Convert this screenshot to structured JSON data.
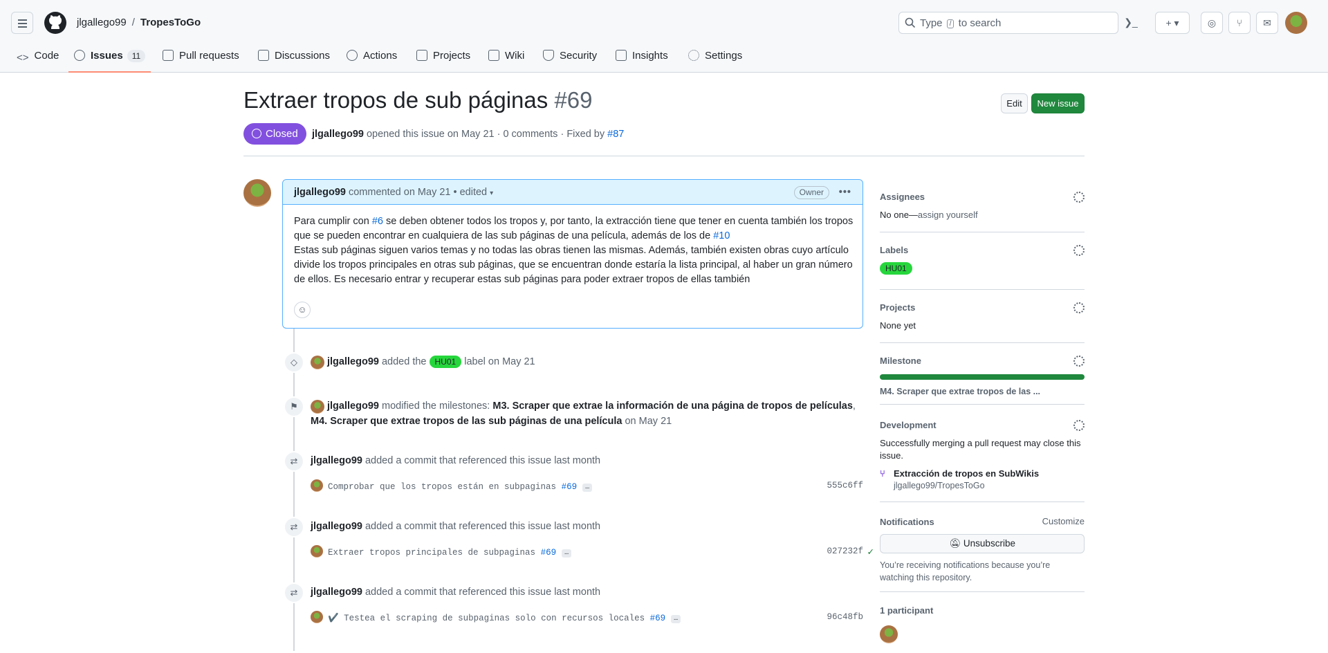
{
  "header": {
    "owner": "jlgallego99",
    "separator": "/",
    "repo": "TropesToGo",
    "search_prefix": "Type",
    "search_key": "/",
    "search_suffix": "to search"
  },
  "tabs": [
    {
      "label": "Code"
    },
    {
      "label": "Issues",
      "count": "11"
    },
    {
      "label": "Pull requests"
    },
    {
      "label": "Discussions"
    },
    {
      "label": "Actions"
    },
    {
      "label": "Projects"
    },
    {
      "label": "Wiki"
    },
    {
      "label": "Security"
    },
    {
      "label": "Insights"
    },
    {
      "label": "Settings"
    }
  ],
  "issue": {
    "title": "Extraer tropos de sub páginas",
    "number": "#69",
    "edit_label": "Edit",
    "new_issue_label": "New issue",
    "state": "Closed",
    "author": "jlgallego99",
    "meta_text": "opened this issue on May 21 · 0 comments · Fixed by",
    "fixed_by": "#87"
  },
  "comment": {
    "author": "jlgallego99",
    "meta": "commented on May 21 • edited",
    "badge": "Owner",
    "kebab": "•••",
    "p1_a": "Para cumplir con ",
    "p1_link": "#6",
    "p1_b": " se deben obtener todos los tropos y, por tanto, la extracción tiene que tener en cuenta también los tropos que se pueden encontrar en cualquiera de las sub páginas de una película, además de los de ",
    "p1_link2": "#10",
    "p2": "Estas sub páginas siguen varios temas y no todas las obras tienen las mismas. Además, también existen obras cuyo artículo divide los tropos principales en otras sub páginas, que se encuentran donde estaría la lista principal, al haber un gran número de ellos. Es necesario entrar y recuperar estas sub páginas para poder extraer tropos de ellas también"
  },
  "events": {
    "label_event": {
      "author": "jlgallego99",
      "pre": "added the",
      "label": "HU01",
      "post": "label on May 21"
    },
    "milestone_event": {
      "author": "jlgallego99",
      "pre": "modified the milestones:",
      "m3": "M3. Scraper que extrae la información de una página de tropos de películas",
      "comma": ",",
      "m4": "M4. Scraper que extrae tropos de las sub páginas de una película",
      "post": "on May 21"
    },
    "commit_events": [
      {
        "author": "jlgallego99",
        "text": "added a commit that referenced this issue last month",
        "message": "Comprobar que los tropos están en subpaginas",
        "ref": "#69",
        "sha": "555c6ff",
        "check": ""
      },
      {
        "author": "jlgallego99",
        "text": "added a commit that referenced this issue last month",
        "message": "Extraer tropos principales de subpaginas",
        "ref": "#69",
        "sha": "027232f",
        "check": "✓"
      },
      {
        "author": "jlgallego99",
        "text": "added a commit that referenced this issue last month",
        "message": "✔️ Testea el scraping de subpaginas solo con recursos locales",
        "ref": "#69",
        "sha": "96c48fb",
        "check": ""
      }
    ],
    "ellipsis": "…"
  },
  "sidebar": {
    "assignees": {
      "title": "Assignees",
      "value": "No one—",
      "link": "assign yourself"
    },
    "labels": {
      "title": "Labels",
      "label": "HU01"
    },
    "projects": {
      "title": "Projects",
      "value": "None yet"
    },
    "milestone": {
      "title": "Milestone",
      "progress": 1.0,
      "name": "M4. Scraper que extrae tropos de las ..."
    },
    "development": {
      "title": "Development",
      "text": "Successfully merging a pull request may close this issue.",
      "pr": "Extracción de tropos en SubWikis",
      "repo": "jlgallego99/TropesToGo"
    },
    "notifications": {
      "title": "Notifications",
      "customize": "Customize",
      "button": "Unsubscribe",
      "text": "You’re receiving notifications because you’re watching this repository."
    },
    "participants": {
      "title": "1 participant"
    }
  },
  "colors": {
    "accent": "#0969da",
    "closed": "#8250df",
    "primary": "#1f883d",
    "label": "#26d63c",
    "tab_underline": "#fd8c73"
  }
}
